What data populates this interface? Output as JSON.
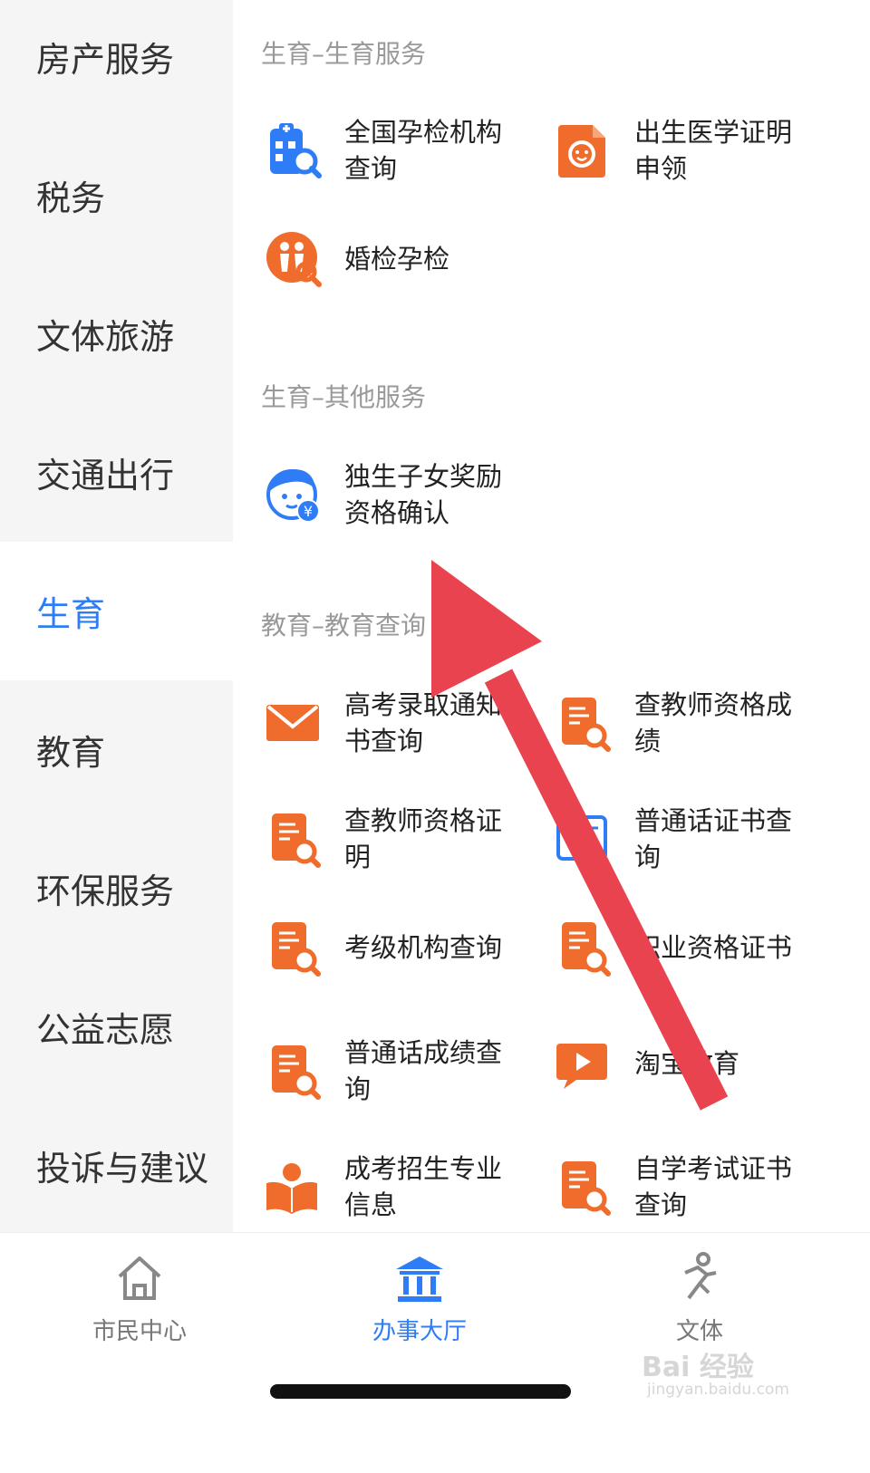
{
  "sidebar": {
    "items": [
      {
        "label": "房产服务"
      },
      {
        "label": "税务"
      },
      {
        "label": "文体旅游"
      },
      {
        "label": "交通出行"
      },
      {
        "label": "生育"
      },
      {
        "label": "教育"
      },
      {
        "label": "环保服务"
      },
      {
        "label": "公益志愿"
      },
      {
        "label": "投诉与建议"
      }
    ],
    "active_label": "生育"
  },
  "sections": [
    {
      "title": "生育–生育服务",
      "items": [
        {
          "label": "全国孕检机构查询",
          "icon": "hospital-search-icon"
        },
        {
          "label": "出生医学证明申领",
          "icon": "baby-document-icon"
        },
        {
          "label": "婚检孕检",
          "icon": "couple-search-icon"
        }
      ]
    },
    {
      "title": "生育–其他服务",
      "items": [
        {
          "label": "独生子女奖励资格确认",
          "icon": "child-yuan-icon"
        }
      ]
    },
    {
      "title": "教育–教育查询",
      "items": [
        {
          "label": "高考录取通知书查询",
          "icon": "envelope-icon"
        },
        {
          "label": "查教师资格成绩",
          "icon": "document-search-icon"
        },
        {
          "label": "查教师资格证明",
          "icon": "document-search-icon"
        },
        {
          "label": "普通话证书查询",
          "icon": "certificate-icon"
        },
        {
          "label": "考级机构查询",
          "icon": "document-search-icon"
        },
        {
          "label": "职业资格证书",
          "icon": "document-search-icon"
        },
        {
          "label": "普通话成绩查询",
          "icon": "document-search-icon"
        },
        {
          "label": "淘宝教育",
          "icon": "video-play-icon"
        },
        {
          "label": "成考招生专业信息",
          "icon": "reader-book-icon"
        },
        {
          "label": "自学考试证书查询",
          "icon": "document-search-icon"
        }
      ]
    }
  ],
  "bottom_nav": {
    "items": [
      {
        "label": "市民中心",
        "icon": "home-icon"
      },
      {
        "label": "办事大厅",
        "icon": "bank-building-icon"
      },
      {
        "label": "文体",
        "icon": "running-person-icon"
      }
    ],
    "active_label": "办事大厅"
  },
  "watermark": {
    "text": "Bai 经验",
    "sub": "jingyan.baidu.com"
  },
  "colors": {
    "accent": "#2e7df6",
    "orange": "#ef6c2c",
    "arrow": "#e8434f"
  }
}
